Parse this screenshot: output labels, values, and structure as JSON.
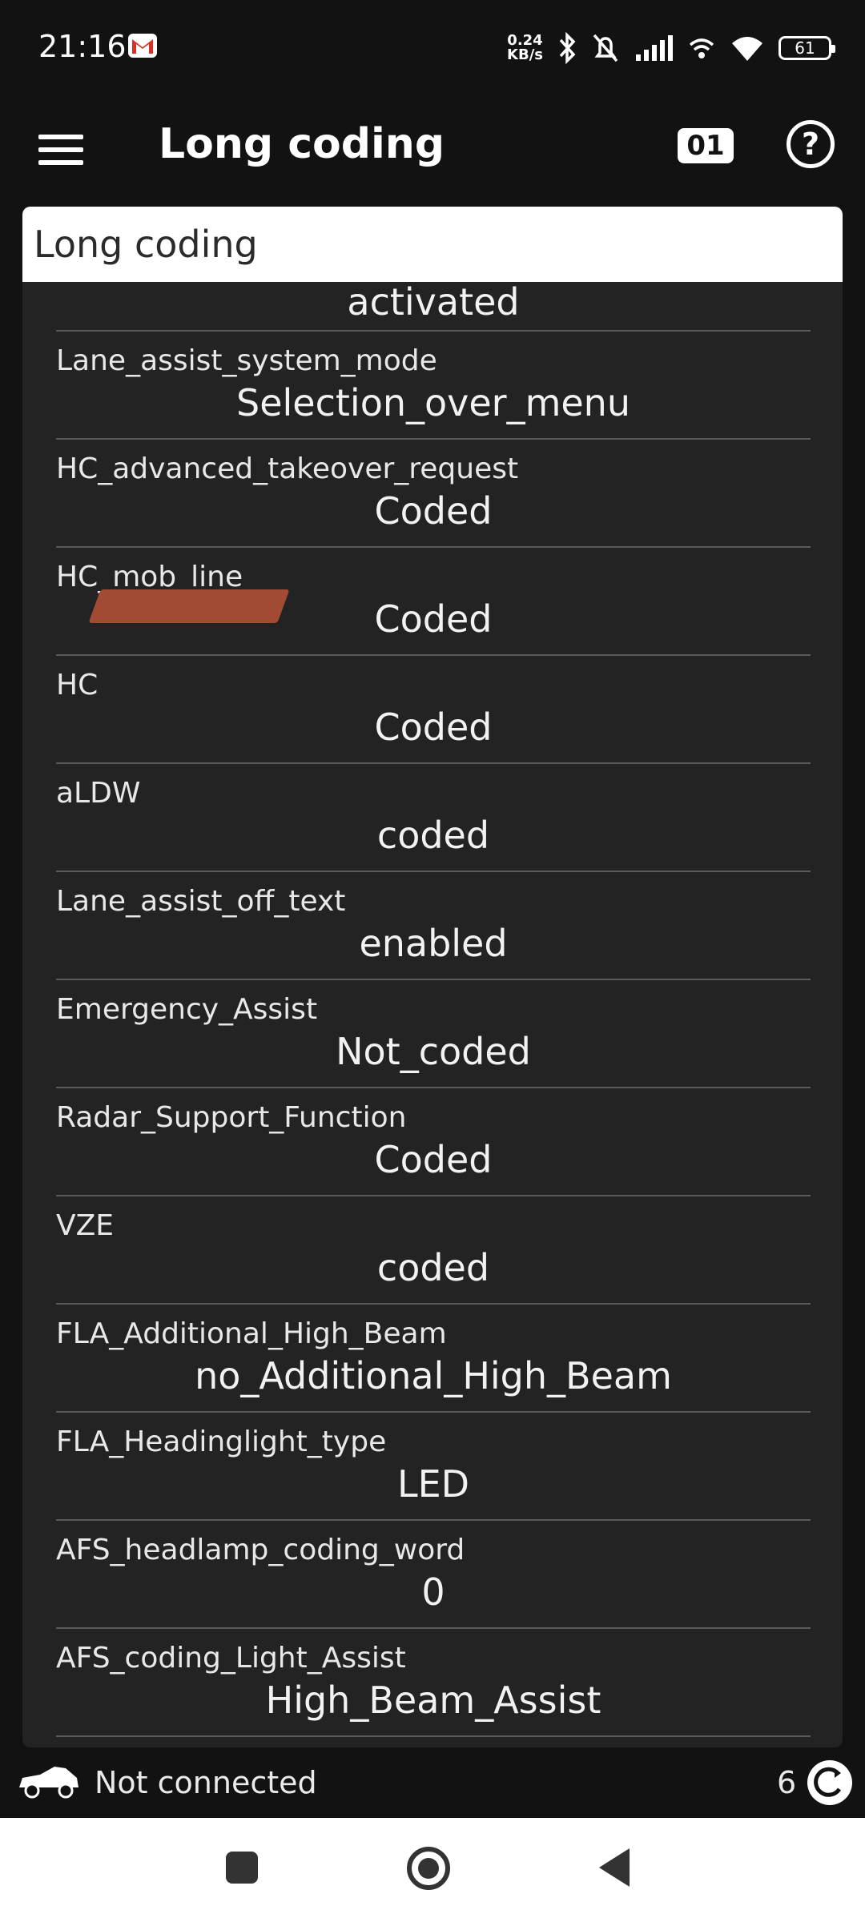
{
  "status_bar": {
    "time": "21:16",
    "net_speed_value": "0.24",
    "net_speed_unit": "KB/s",
    "battery": "61"
  },
  "app_bar": {
    "title": "Long coding",
    "binary_icon_text": "01"
  },
  "card": {
    "header": "Long coding",
    "top_value": "activated",
    "rows": [
      {
        "label": "Lane_assist_system_mode",
        "value": "Selection_over_menu"
      },
      {
        "label": "HC_advanced_takeover_request",
        "value": "Coded"
      },
      {
        "label": "HC_mob_line",
        "value": "Coded"
      },
      {
        "label": "HC",
        "value": "Coded"
      },
      {
        "label": "aLDW",
        "value": "coded"
      },
      {
        "label": "Lane_assist_off_text",
        "value": "enabled"
      },
      {
        "label": "Emergency_Assist",
        "value": "Not_coded"
      },
      {
        "label": "Radar_Support_Function",
        "value": "Coded"
      },
      {
        "label": "VZE",
        "value": "coded"
      },
      {
        "label": "FLA_Additional_High_Beam",
        "value": "no_Additional_High_Beam"
      },
      {
        "label": "FLA_Headinglight_type",
        "value": "LED"
      },
      {
        "label": "AFS_headlamp_coding_word",
        "value": "0"
      },
      {
        "label": "AFS_coding_Light_Assist",
        "value": "High_Beam_Assist"
      }
    ]
  },
  "connection": {
    "status": "Not connected",
    "count": "6"
  },
  "colors": {
    "background": "#121212",
    "card": "#232323",
    "redaction": "#a34a34"
  }
}
